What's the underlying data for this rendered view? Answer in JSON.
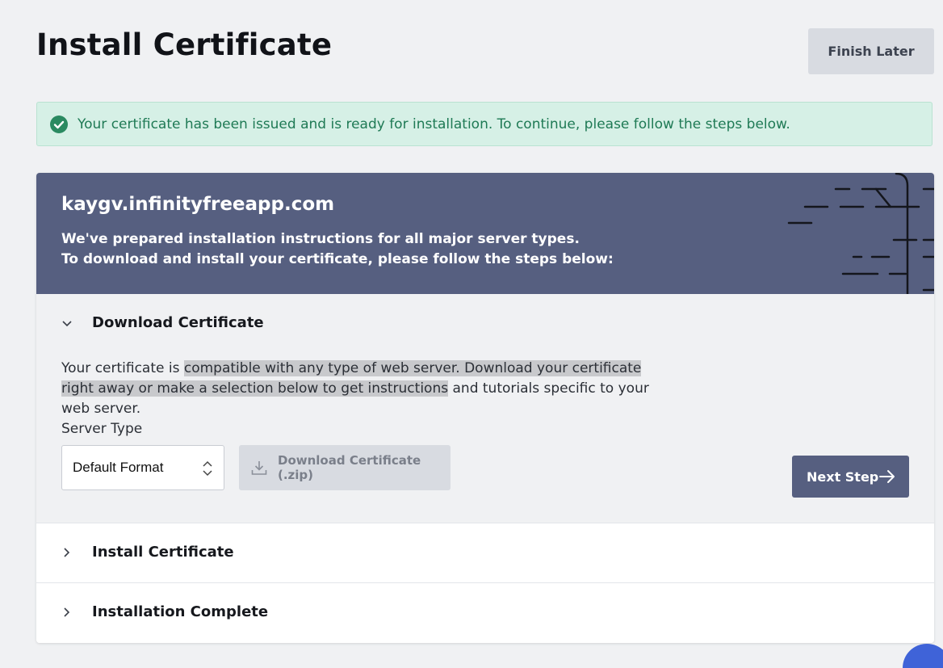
{
  "header": {
    "title": "Install Certificate",
    "finish_later_label": "Finish Later"
  },
  "alert": {
    "icon": "check-circle-icon",
    "text": "Your certificate has been issued and is ready for installation. To continue, please follow the steps below.",
    "color": "#1f7a55",
    "background": "#d6f0e6"
  },
  "card": {
    "domain": "kaygv.infinityfreeapp.com",
    "intro_line_1": "We've prepared installation instructions for all major server types.",
    "intro_line_2": "To download and install your certificate, please follow the steps below:",
    "header_color": "#565f80"
  },
  "steps": [
    {
      "title": "Download Certificate",
      "expanded": true,
      "description_plain_1": "Your certificate is ",
      "description_highlight": "compatible with any type of web server. Download your certificate right away or make a selection below to get instructions",
      "description_plain_2": " and tutorials specific to your web server.",
      "server_type_label": "Server Type",
      "server_type_value": "Default Format",
      "download_button_label": "Download Certificate (.zip)",
      "next_button_label": "Next Step"
    },
    {
      "title": "Install Certificate",
      "expanded": false
    },
    {
      "title": "Installation Complete",
      "expanded": false
    }
  ]
}
